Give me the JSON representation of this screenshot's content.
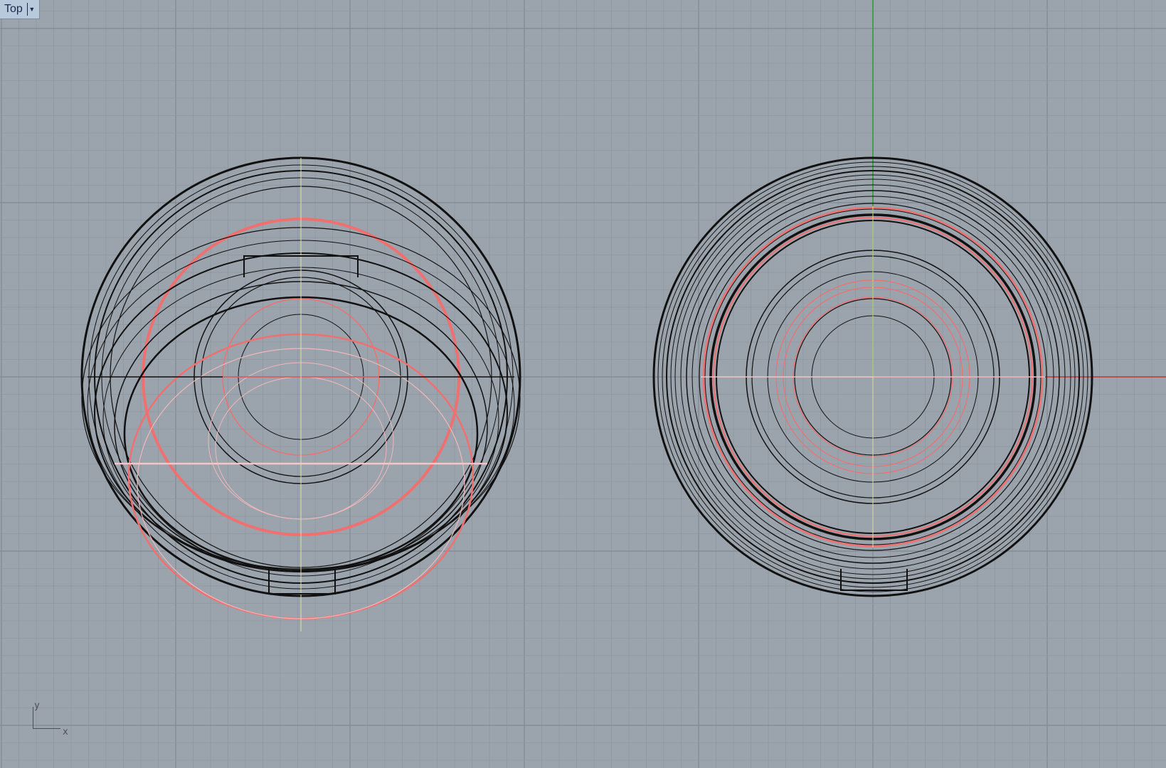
{
  "viewport": {
    "label": "Top",
    "menu_icon": "dropdown-arrow-icon",
    "background_color": "#9ba3ad",
    "grid_minor_color": "#8e969f",
    "grid_major_color": "#818993",
    "world_x_axis_color": "#c0392b",
    "world_y_axis_color": "#2e9a3a",
    "curve_color": "#111111",
    "highlight_curve_color": "#f07070"
  },
  "axis_widget": {
    "x_label": "x",
    "y_label": "y"
  }
}
